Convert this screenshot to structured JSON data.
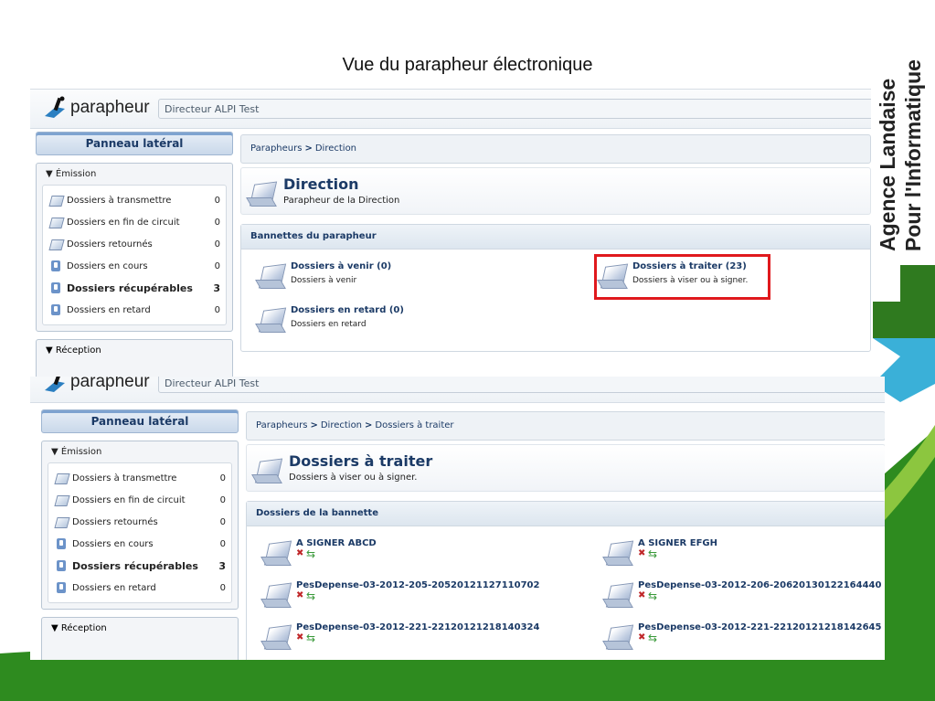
{
  "slide": {
    "title": "Vue du parapheur électronique",
    "agency_line1": "Agence Landaise",
    "agency_line2": "Pour l'Informatique"
  },
  "app": {
    "logo_text": "parapheur",
    "user": "Directeur ALPI Test"
  },
  "sidebar": {
    "header": "Panneau latéral",
    "emission_title": "▼ Émission",
    "reception_title": "▼ Réception",
    "items": [
      {
        "label": "Dossiers à transmettre",
        "count": "0",
        "icon": "folder-icon"
      },
      {
        "label": "Dossiers en fin de circuit",
        "count": "0",
        "icon": "folder-icon"
      },
      {
        "label": "Dossiers retournés",
        "count": "0",
        "icon": "folder-icon"
      },
      {
        "label": "Dossiers en cours",
        "count": "0",
        "icon": "tray-icon"
      },
      {
        "label": "Dossiers récupérables",
        "count": "3",
        "icon": "tray-icon"
      },
      {
        "label": "Dossiers en retard",
        "count": "0",
        "icon": "tray-icon"
      }
    ]
  },
  "screen1": {
    "breadcrumb": [
      "Parapheurs",
      "Direction"
    ],
    "panel_title": "Direction",
    "panel_subtitle": "Parapheur de la Direction",
    "section_title": "Bannettes du parapheur",
    "bannettes": [
      {
        "title": "Dossiers à venir (0)",
        "subtitle": "Dossiers à venir"
      },
      {
        "title": "Dossiers à traiter (23)",
        "subtitle": "Dossiers à viser ou à signer."
      },
      {
        "title": "Dossiers en retard (0)",
        "subtitle": "Dossiers en retard"
      }
    ]
  },
  "screen2": {
    "breadcrumb": [
      "Parapheurs",
      "Direction",
      "Dossiers à traiter"
    ],
    "panel_title": "Dossiers à traiter",
    "panel_subtitle": "Dossiers à viser ou à signer.",
    "section_title": "Dossiers de la bannette",
    "dossiers": [
      "A SIGNER ABCD",
      "A SIGNER EFGH",
      "PesDepense-03-2012-205-20520121127110702",
      "PesDepense-03-2012-206-20620130122164440",
      "PesDepense-03-2012-221-22120121218140324",
      "PesDepense-03-2012-221-22120121218142645"
    ]
  },
  "colors": {
    "highlight": "#e0191d",
    "brand_green": "#2f7a1f",
    "brand_blue": "#3ab0d8"
  }
}
